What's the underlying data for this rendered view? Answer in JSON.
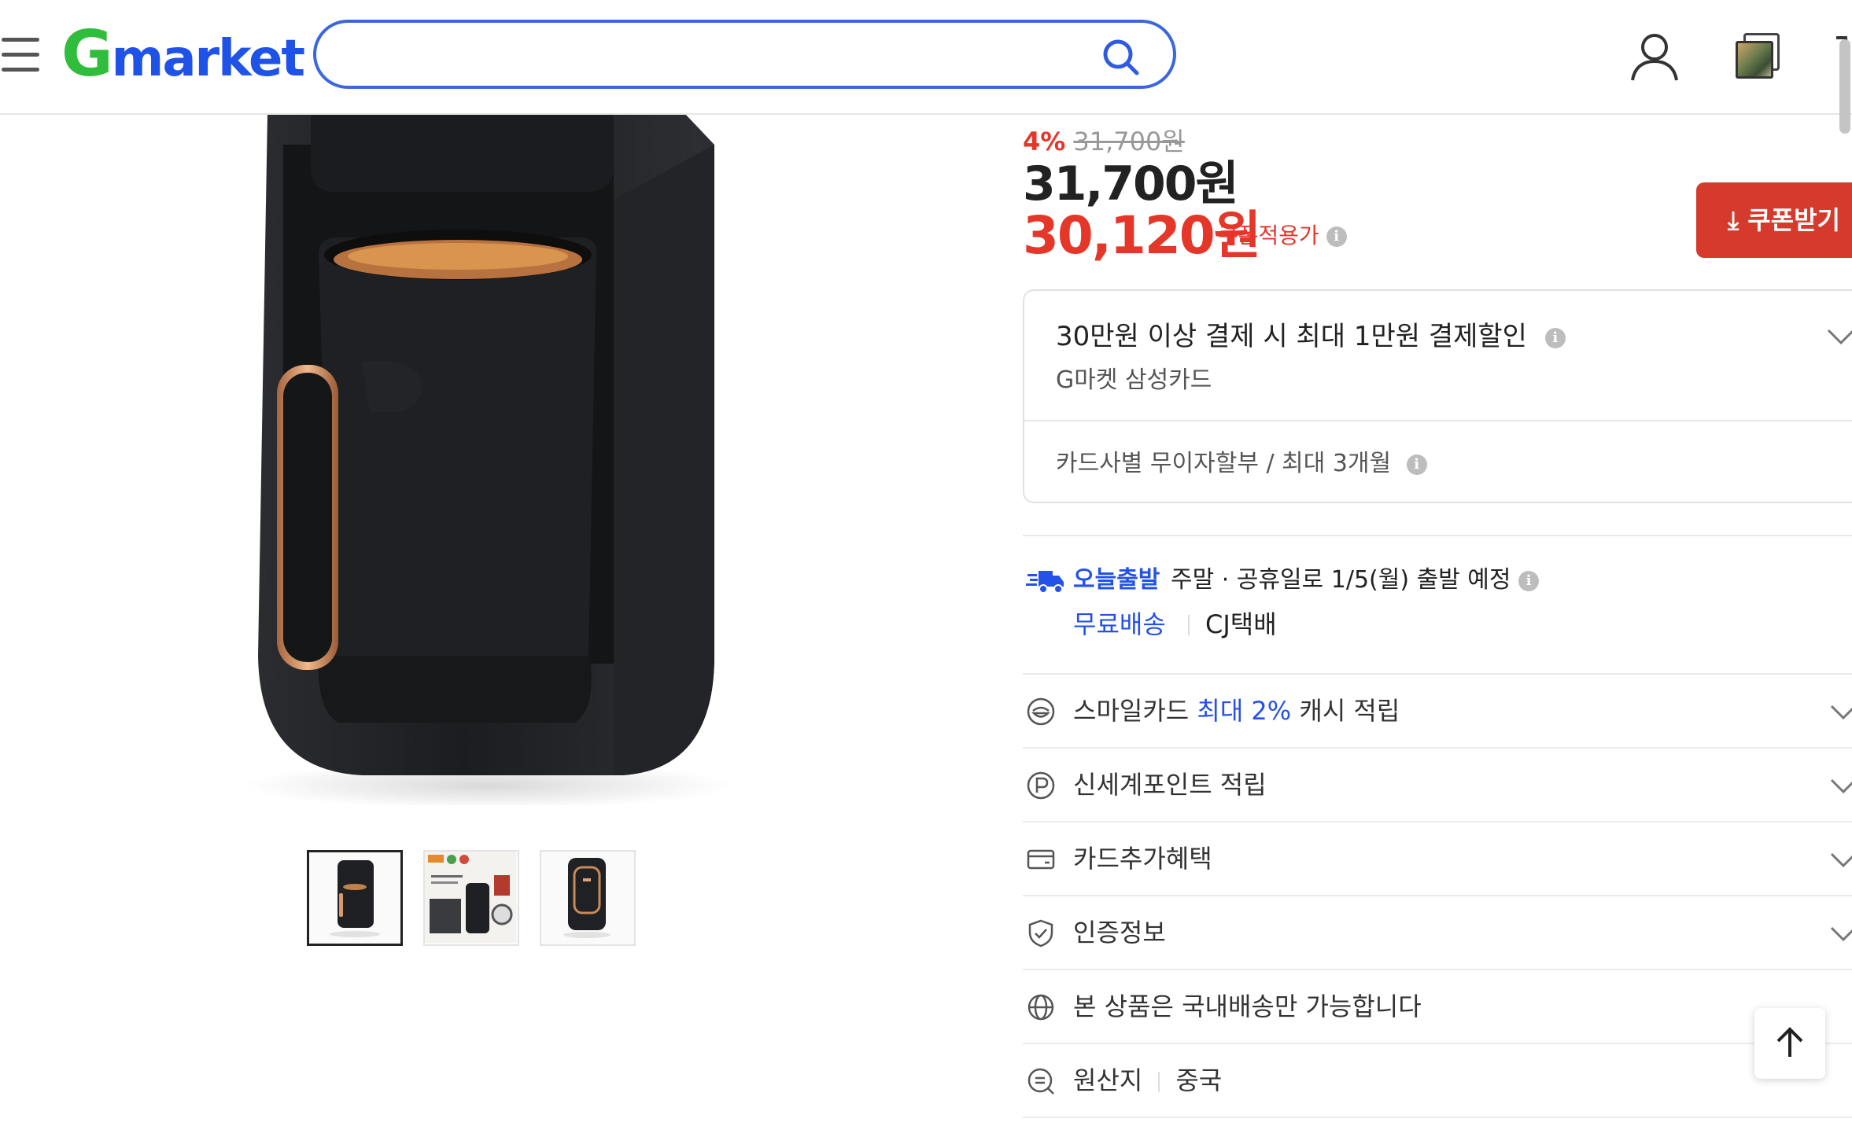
{
  "header": {
    "logo_text": "market",
    "logo_g": "G",
    "search": {
      "value": "",
      "placeholder": ""
    },
    "icons": [
      "menu-icon",
      "search-icon",
      "user-icon",
      "recent-items-icon",
      "cart-icon"
    ]
  },
  "price": {
    "discount_rate": "4%",
    "original_price": "31,700원",
    "price": "31,700원",
    "coupon_price": "30,120원",
    "coupon_label": "쿠폰적용가",
    "coupon_button": "쿠폰받기"
  },
  "card_benefit": {
    "title": "30만원 이상 결제 시 최대 1만원 결제할인",
    "subtitle": "G마켓 삼성카드",
    "installment": "카드사별 무이자할부 / 최대 3개월"
  },
  "delivery": {
    "today_label": "오늘출발",
    "text": "주말 · 공휴일로 1/5(월) 출발 예정",
    "free_shipping": "무료배송",
    "carrier": "CJ택배"
  },
  "info_rows": {
    "smile_prefix": "스마일카드",
    "smile_highlight": "최대 2%",
    "smile_suffix": "캐시 적립",
    "point": "신세계포인트 적립",
    "card_extra": "카드추가혜택",
    "certification": "인증정보",
    "domestic": "본 상품은 국내배송만 가능합니다",
    "origin_label": "원산지",
    "origin_value": "중국"
  },
  "gallery": {
    "thumbnail_count": 3,
    "active_index": 0
  },
  "colors": {
    "accent_red": "#e5362a",
    "brand_blue": "#2452e8",
    "coupon_button": "#d63a2c",
    "logo_green": "#2fbd3b"
  }
}
